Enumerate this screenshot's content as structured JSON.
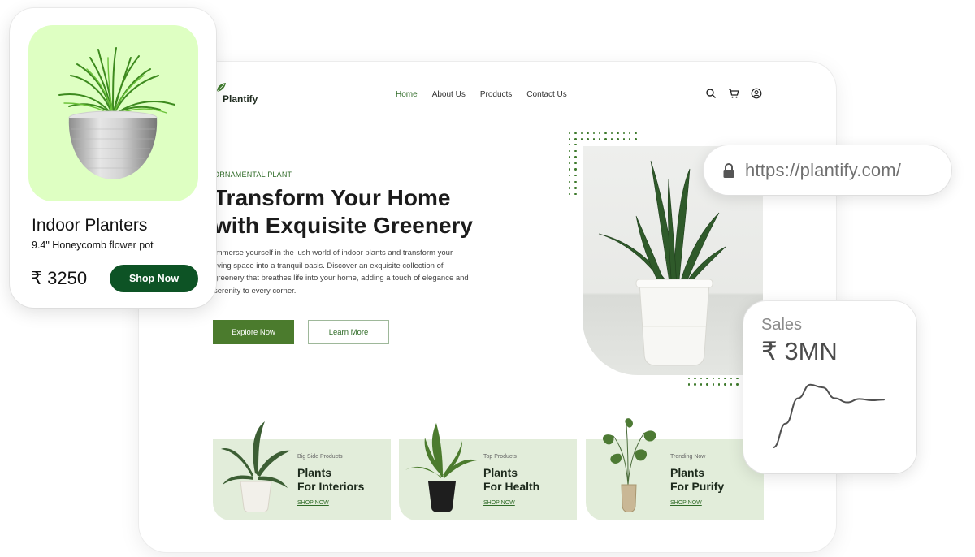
{
  "site": {
    "brand": "Plantify",
    "nav": [
      {
        "label": "Home",
        "active": true
      },
      {
        "label": "About Us",
        "active": false
      },
      {
        "label": "Products",
        "active": false
      },
      {
        "label": "Contact Us",
        "active": false
      }
    ],
    "nav_icons": [
      "search-icon",
      "cart-icon",
      "user-icon"
    ],
    "hero": {
      "eyebrow": "ORNAMENTAL PLANT",
      "title_line1": "Transform Your Home",
      "title_line2": "with Exquisite Greenery",
      "description": "Immerse yourself in the lush world of indoor plants and transform your living space into a tranquil oasis. Discover an exquisite collection of greenery that breathes life into your home, adding a touch of elegance and serenity to every corner.",
      "primary_button": "Explore Now",
      "secondary_button": "Learn More"
    },
    "categories": [
      {
        "kicker": "Big Side Products",
        "title_line1": "Plants",
        "title_line2": "For Interiors",
        "link": "SHOP NOW"
      },
      {
        "kicker": "Top Products",
        "title_line1": "Plants",
        "title_line2": "For Health",
        "link": "SHOP NOW"
      },
      {
        "kicker": "Trending Now",
        "title_line1": "Plants",
        "title_line2": "For Purify",
        "link": "SHOP NOW"
      }
    ]
  },
  "product_card": {
    "name": "Indoor Planters",
    "subtitle": "9.4\" Honeycomb flower pot",
    "price": "₹ 3250",
    "button": "Shop Now"
  },
  "url_bar": {
    "url": "https://plantify.com/",
    "icon": "lock-icon"
  },
  "sales_card": {
    "label": "Sales",
    "value": "₹ 3MN",
    "trend": [
      0.0,
      0.35,
      0.72,
      0.92,
      0.88,
      0.72,
      0.66,
      0.71,
      0.69,
      0.7
    ]
  },
  "colors": {
    "brand_green": "#2f6b27",
    "button_green": "#4b7b2d",
    "shop_button": "#0d5325",
    "product_bg": "#deffc2",
    "category_bg": "#e2edda"
  }
}
